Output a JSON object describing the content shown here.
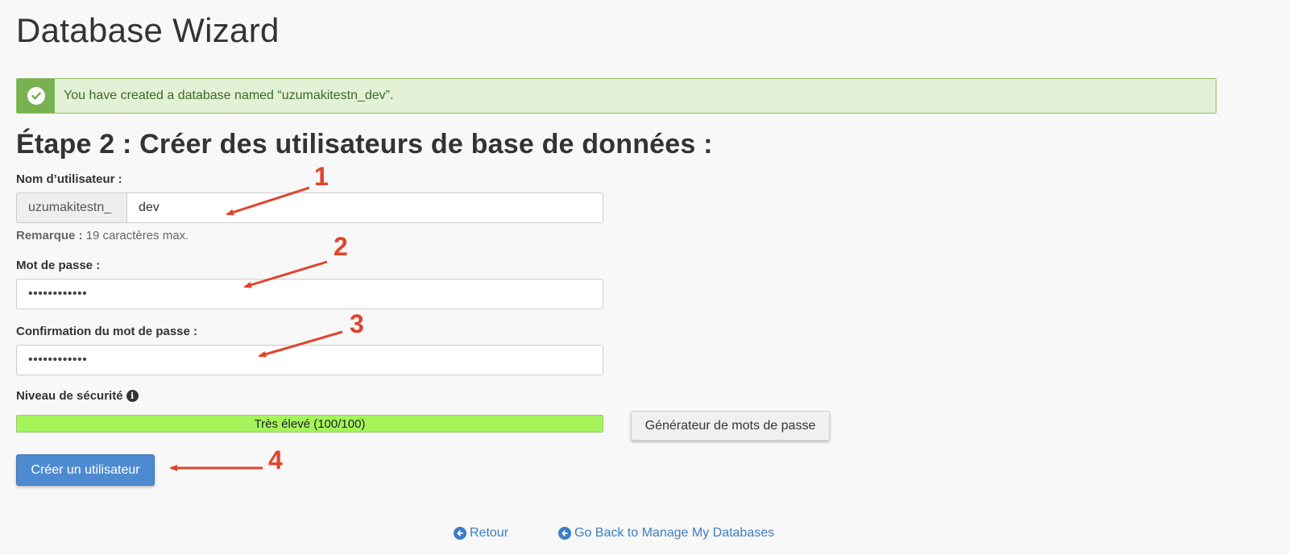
{
  "page": {
    "title": "Database Wizard"
  },
  "alert": {
    "message": "You have created a database named “uzumakitestn_dev”.",
    "icon": "check-circle-icon",
    "color": "#77b150"
  },
  "step": {
    "title": "Étape 2 : Créer des utilisateurs de base de données :"
  },
  "form": {
    "username": {
      "label": "Nom d’utilisateur :",
      "prefix": "uzumakitestn_",
      "value": "dev",
      "note_label": "Remarque :",
      "note_text": " 19 caractères max."
    },
    "password": {
      "label": "Mot de passe :",
      "value": "••••••••••••"
    },
    "password_confirm": {
      "label": "Confirmation du mot de passe :",
      "value": "••••••••••••"
    },
    "strength": {
      "label": "Niveau de sécurité",
      "icon": "info-icon",
      "text": "Très élevé (100/100)",
      "score": 100,
      "color": "#a4f55b"
    },
    "generator_button": "Générateur de mots de passe",
    "submit_button": "Créer un utilisateur"
  },
  "footer": {
    "back_label": "Retour",
    "manage_label": "Go Back to Manage My Databases"
  },
  "annotations": {
    "color": "#e0442c",
    "numbers": [
      "1",
      "2",
      "3",
      "4"
    ]
  }
}
